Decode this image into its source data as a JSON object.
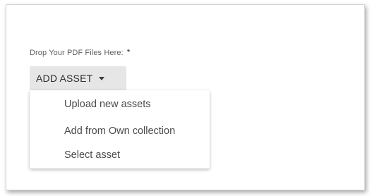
{
  "form": {
    "drop_label": "Drop Your PDF Files Here:",
    "required_marker": "*"
  },
  "add_asset": {
    "label": "ADD ASSET",
    "caret_icon": "caret-down-icon"
  },
  "menu": {
    "items": [
      {
        "label": "Upload new assets"
      },
      {
        "label": "Add from Own collection"
      },
      {
        "label": "Select asset"
      }
    ]
  }
}
